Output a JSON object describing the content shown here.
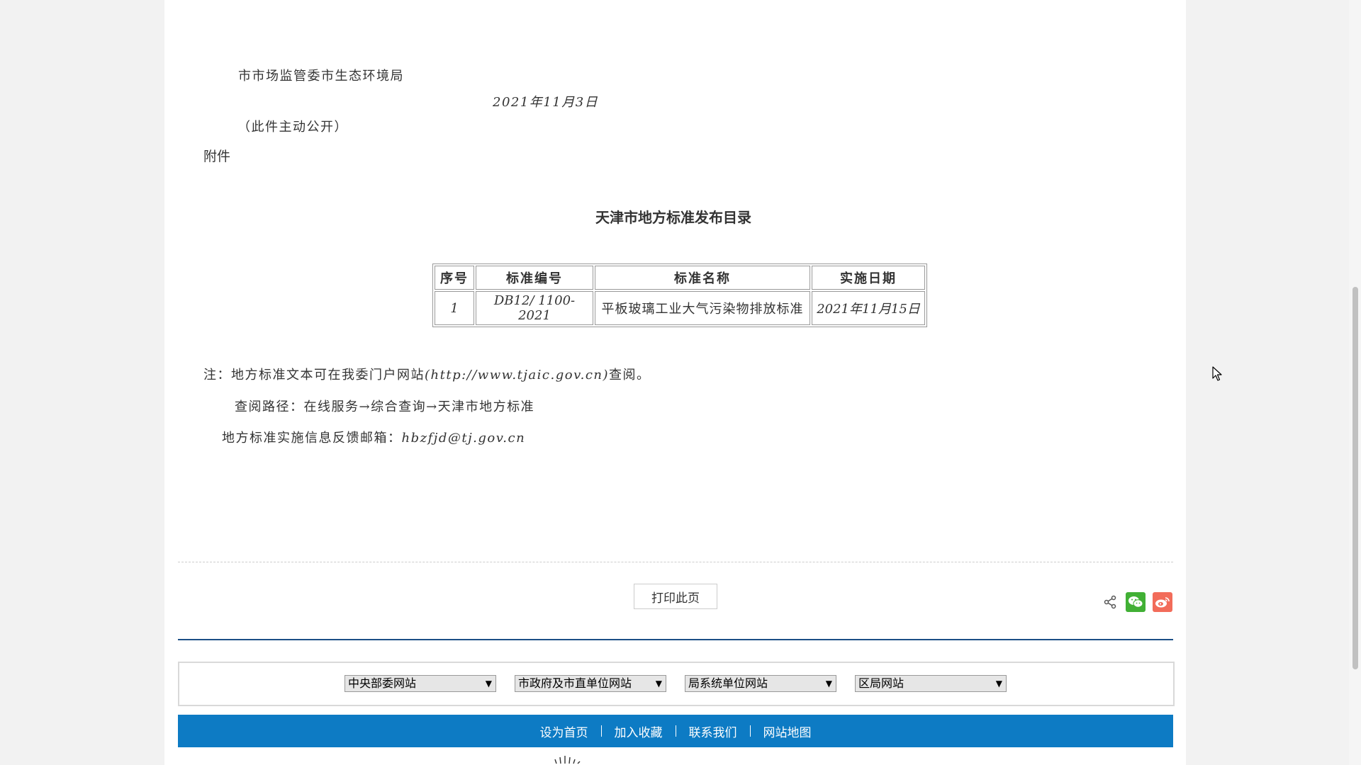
{
  "document": {
    "signatory": "市市场监管委市生态环境局",
    "date": "2021年11月3日",
    "public_note": "（此件主动公开）",
    "attachment_label": "附件",
    "title": "天津市地方标准发布目录"
  },
  "table": {
    "headers": [
      "序号",
      "标准编号",
      "标准名称",
      "实施日期"
    ],
    "rows": [
      [
        "1",
        "DB12/ 1100-2021",
        "平板玻璃工业大气污染物排放标准",
        "2021年11月15日"
      ]
    ]
  },
  "notes": {
    "line1_prefix": "注：地方标准文本可在我委门户网站",
    "line1_url": "(http://www.tjaic.gov.cn)",
    "line1_suffix": "查阅。",
    "line2": "查阅路径：在线服务→综合查询→天津市地方标准",
    "line3_prefix": "地方标准实施信息反馈邮箱：",
    "line3_email": "hbzfjd@tj.gov.cn"
  },
  "actions": {
    "print_label": "打印此页",
    "share_icons": [
      "share-icon",
      "wechat-icon",
      "weibo-icon"
    ],
    "wechat_color": "#41b035",
    "weibo_color": "#f26c5a"
  },
  "link_selects": [
    "中央部委网站",
    "市政府及市直单位网站",
    "局系统单位网站",
    "区局网站"
  ],
  "footer": {
    "links": [
      "设为首页",
      "加入收藏",
      "联系我们",
      "网站地图"
    ],
    "bar_color": "#0d7bc4"
  }
}
